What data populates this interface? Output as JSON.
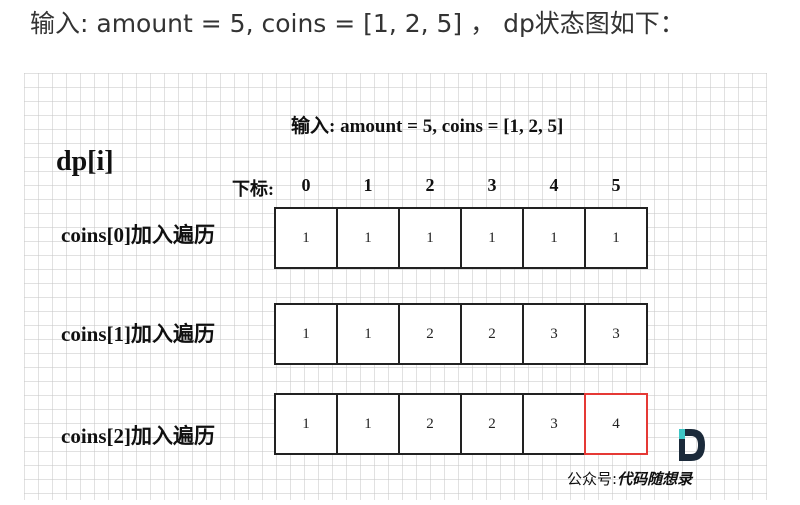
{
  "header": {
    "text": "输入: amount = 5, coins = [1, 2, 5] ，  dp状态图如下："
  },
  "figure": {
    "subtitle": "输入: amount = 5, coins = [1, 2, 5]",
    "dp_label": "dp[i]",
    "index_caption": "下标:",
    "indices": [
      "0",
      "1",
      "2",
      "3",
      "4",
      "5"
    ],
    "rows": [
      {
        "label": "coins[0]加入遍历",
        "values": [
          "1",
          "1",
          "1",
          "1",
          "1",
          "1"
        ]
      },
      {
        "label": "coins[1]加入遍历",
        "values": [
          "1",
          "1",
          "2",
          "2",
          "3",
          "3"
        ]
      },
      {
        "label": "coins[2]加入遍历",
        "values": [
          "1",
          "1",
          "2",
          "2",
          "3",
          "4"
        ]
      }
    ],
    "highlight": {
      "row": 2,
      "col": 5,
      "color": "#e53935"
    },
    "watermark_prefix": "公众号:",
    "watermark_brand": "代码随想录",
    "logo_icon": "d-logo-icon"
  }
}
